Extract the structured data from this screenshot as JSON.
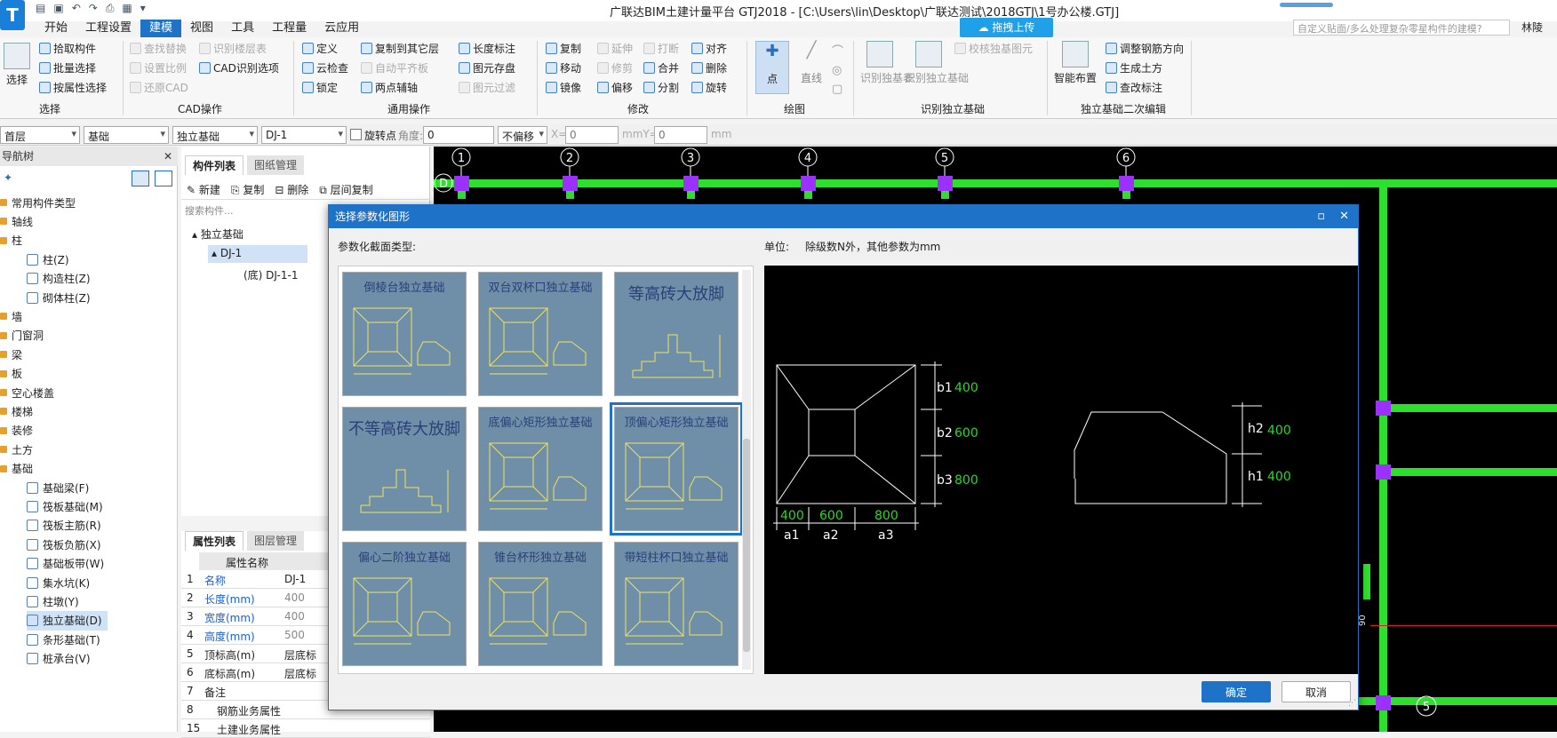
{
  "app": {
    "title": "广联达BIM土建计量平台 GTJ2018 - [C:\\Users\\lin\\Desktop\\广联达测试\\2018GTJ\\1号办公楼.GTJ]",
    "logo_letter": "T",
    "search_placeholder": "自定义贴面/多么处理复杂零星构件的建模?",
    "user": "林陵",
    "cloud_button": "拖拽上传"
  },
  "menu": [
    "开始",
    "工程设置",
    "建模",
    "视图",
    "工具",
    "工程量",
    "云应用"
  ],
  "menu_active": "建模",
  "ribbon": {
    "select": {
      "big": "选择",
      "items": [
        "拾取构件",
        "批量选择",
        "按属性选择"
      ],
      "label": "选择"
    },
    "cad": {
      "items": [
        "查找替换",
        "设置比例",
        "还原CAD",
        "识别楼层表",
        "CAD识别选项"
      ],
      "label": "CAD操作"
    },
    "common": {
      "items": [
        "定义",
        "云检查",
        "锁定",
        "复制到其它层",
        "自动平齐板",
        "两点辅轴",
        "长度标注",
        "图元存盘",
        "图元过滤"
      ],
      "label": "通用操作"
    },
    "modify": {
      "items": [
        "复制",
        "移动",
        "镜像",
        "延伸",
        "修剪",
        "偏移",
        "打断",
        "合并",
        "分割",
        "对齐",
        "删除",
        "旋转"
      ],
      "label": "修改"
    },
    "draw": {
      "items": [
        "点",
        "直线"
      ],
      "label": "绘图"
    },
    "recognize": {
      "items": [
        "识别独基表",
        "识别独立基础",
        "校核独基图元"
      ],
      "label": "识别独立基础"
    },
    "secondary": {
      "items": [
        "智能布置",
        "调整钢筋方向",
        "生成土方",
        "查改标注"
      ],
      "label": "独立基础二次编辑"
    }
  },
  "propbar": {
    "floor": "首层",
    "category": "基础",
    "type": "独立基础",
    "name": "DJ-1",
    "rotate_label": "旋转点",
    "angle_label": "角度:",
    "angle": "0",
    "offset": "不偏移",
    "x_label": "X=",
    "x": "0",
    "mm_y": "mmY=",
    "y": "0",
    "mm": "mm"
  },
  "nav": {
    "title": "导航树",
    "items": [
      {
        "label": "常用构件类型",
        "level": 0
      },
      {
        "label": "轴线",
        "level": 0
      },
      {
        "label": "柱",
        "level": 0
      },
      {
        "label": "柱(Z)",
        "level": 1
      },
      {
        "label": "构造柱(Z)",
        "level": 1
      },
      {
        "label": "砌体柱(Z)",
        "level": 1
      },
      {
        "label": "墙",
        "level": 0
      },
      {
        "label": "门窗洞",
        "level": 0
      },
      {
        "label": "梁",
        "level": 0
      },
      {
        "label": "板",
        "level": 0
      },
      {
        "label": "空心楼盖",
        "level": 0
      },
      {
        "label": "楼梯",
        "level": 0
      },
      {
        "label": "装修",
        "level": 0
      },
      {
        "label": "土方",
        "level": 0
      },
      {
        "label": "基础",
        "level": 0
      },
      {
        "label": "基础梁(F)",
        "level": 1
      },
      {
        "label": "筏板基础(M)",
        "level": 1
      },
      {
        "label": "筏板主筋(R)",
        "level": 1
      },
      {
        "label": "筏板负筋(X)",
        "level": 1
      },
      {
        "label": "基础板带(W)",
        "level": 1
      },
      {
        "label": "集水坑(K)",
        "level": 1
      },
      {
        "label": "柱墩(Y)",
        "level": 1
      },
      {
        "label": "独立基础(D)",
        "level": 1,
        "selected": true
      },
      {
        "label": "条形基础(T)",
        "level": 1
      },
      {
        "label": "桩承台(V)",
        "level": 1
      }
    ]
  },
  "complist": {
    "tabs": [
      "构件列表",
      "图纸管理"
    ],
    "tools": [
      "新建",
      "复制",
      "删除",
      "层间复制"
    ],
    "search": "搜索构件...",
    "tree": [
      "独立基础",
      "DJ-1",
      "(底)  DJ-1-1"
    ]
  },
  "props": {
    "tabs": [
      "属性列表",
      "图层管理"
    ],
    "header": "属性名称",
    "rows": [
      {
        "n": "1",
        "name": "名称",
        "value": "DJ-1",
        "blue": true
      },
      {
        "n": "2",
        "name": "长度(mm)",
        "value": "400",
        "blue": true
      },
      {
        "n": "3",
        "name": "宽度(mm)",
        "value": "400",
        "blue": true
      },
      {
        "n": "4",
        "name": "高度(mm)",
        "value": "500",
        "blue": true
      },
      {
        "n": "5",
        "name": "顶标高(m)",
        "value": "层底标",
        "blue": false
      },
      {
        "n": "6",
        "name": "底标高(m)",
        "value": "层底标",
        "blue": false
      },
      {
        "n": "7",
        "name": "备注",
        "value": "",
        "blue": false
      },
      {
        "n": "8",
        "name": "钢筋业务属性",
        "value": "",
        "blue": false
      },
      {
        "n": "15",
        "name": "土建业务属性",
        "value": "",
        "blue": false
      }
    ]
  },
  "canvas": {
    "axis_top": [
      "1",
      "2",
      "3",
      "4",
      "5",
      "6"
    ],
    "axis_left": "D",
    "axis_bottom": "5",
    "dim_label": "90"
  },
  "dialog": {
    "title": "选择参数化图形",
    "section_label": "参数化截面类型:",
    "unit_label": "单位:",
    "unit_text": "除级数N外，其他参数为mm",
    "shapes": [
      {
        "caption": "倒棱台独立基础"
      },
      {
        "caption": "双台双杯口独立基础"
      },
      {
        "caption": "等高砖大放脚"
      },
      {
        "caption": "不等高砖大放脚"
      },
      {
        "caption": "底偏心矩形独立基础"
      },
      {
        "caption": "顶偏心矩形独立基础",
        "selected": true
      },
      {
        "caption": "偏心二阶独立基础"
      },
      {
        "caption": "锥台杯形独立基础"
      },
      {
        "caption": "带短柱杯口独立基础"
      }
    ],
    "preview": {
      "b1": "400",
      "b2": "600",
      "b3": "800",
      "a1": "400",
      "a2": "600",
      "a3": "800",
      "h1": "400",
      "h2": "400",
      "labels": {
        "b1": "b1",
        "b2": "b2",
        "b3": "b3",
        "a1": "a1",
        "a2": "a2",
        "a3": "a3",
        "h1": "h1",
        "h2": "h2"
      }
    },
    "ok": "确定",
    "cancel": "取消"
  },
  "colors": {
    "accent": "#1e73c8",
    "beam": "#2ee02e",
    "node": "#9b30ff",
    "dim_value": "#22dd22"
  }
}
